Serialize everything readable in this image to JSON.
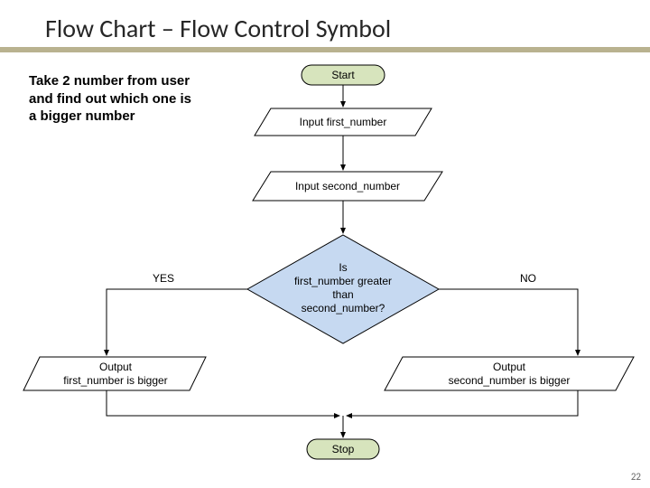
{
  "title": "Flow  Chart – Flow Control Symbol",
  "description": "Take 2 number from user and find out which one is a bigger number",
  "nodes": {
    "start": "Start",
    "input1": "Input first_number",
    "input2": "Input second_number",
    "decision_l1": "Is",
    "decision_l2": "first_number greater",
    "decision_l3": "than",
    "decision_l4": "second_number?",
    "yes": "YES",
    "no": "NO",
    "out1_l1": "Output",
    "out1_l2": "first_number is bigger",
    "out2_l1": "Output",
    "out2_l2": "second_number is bigger",
    "stop": "Stop"
  },
  "pagenum": "22"
}
